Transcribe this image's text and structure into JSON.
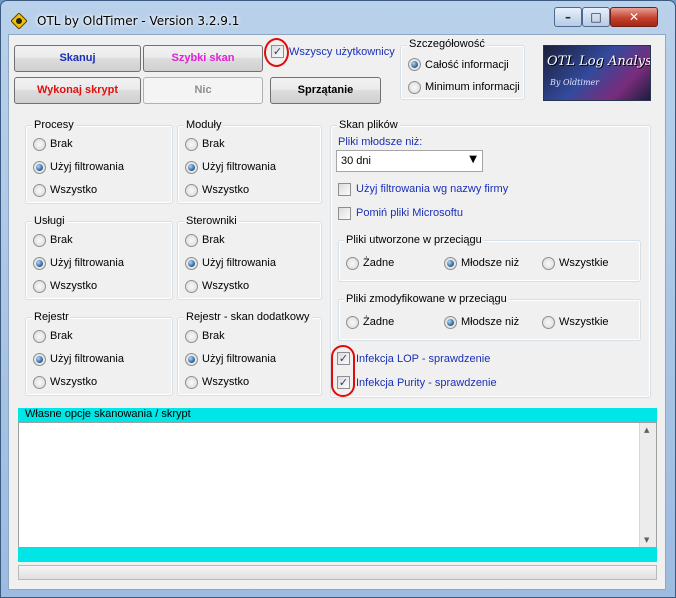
{
  "window": {
    "title": "OTL by OldTimer - Version 3.2.9.1",
    "minimize": "–",
    "maximize": "□",
    "close": "✕"
  },
  "toolbar": {
    "scan": "Skanuj",
    "quick_scan": "Szybki skan",
    "all_users": "Wszyscy użytkownicy",
    "all_users_checked": true,
    "run_script": "Wykonaj skrypt",
    "none": "Nic",
    "cleanup": "Sprzątanie"
  },
  "detail": {
    "title": "Szczegółowość",
    "full": "Całość informacji",
    "minimum": "Minimum informacji",
    "selected": "full"
  },
  "logo": {
    "line1": "OTL Log Analysis",
    "line2": "By Oldtimer"
  },
  "groups": {
    "procesy": {
      "title": "Procesy",
      "options": [
        "Brak",
        "Użyj filtrowania",
        "Wszystko"
      ],
      "selected": 1
    },
    "moduly": {
      "title": "Moduły",
      "options": [
        "Brak",
        "Użyj filtrowania",
        "Wszystko"
      ],
      "selected": 1
    },
    "uslugi": {
      "title": "Usługi",
      "options": [
        "Brak",
        "Użyj filtrowania",
        "Wszystko"
      ],
      "selected": 1
    },
    "sterowniki": {
      "title": "Sterowniki",
      "options": [
        "Brak",
        "Użyj filtrowania",
        "Wszystko"
      ],
      "selected": 1
    },
    "rejestr": {
      "title": "Rejestr",
      "options": [
        "Brak",
        "Użyj filtrowania",
        "Wszystko"
      ],
      "selected": 1
    },
    "rejestr_extra": {
      "title": "Rejestr - skan dodatkowy",
      "options": [
        "Brak",
        "Użyj filtrowania",
        "Wszystko"
      ],
      "selected": 1
    }
  },
  "file_scan": {
    "title": "Skan plików",
    "newer_label": "Pliki młodsze niż:",
    "newer_value": "30 dni",
    "company_filter": "Użyj filtrowania wg nazwy firmy",
    "company_filter_checked": false,
    "skip_ms": "Pomiń pliki Microsoftu",
    "skip_ms_checked": false,
    "created": {
      "title": "Pliki utworzone w przeciągu",
      "options": [
        "Żadne",
        "Młodsze niż",
        "Wszystkie"
      ],
      "selected": 1
    },
    "modified": {
      "title": "Pliki zmodyfikowane w przeciągu",
      "options": [
        "Żadne",
        "Młodsze niż",
        "Wszystkie"
      ],
      "selected": 1
    },
    "lop": "Infekcja LOP - sprawdzenie",
    "lop_checked": true,
    "purity": "Infekcja Purity - sprawdzenie",
    "purity_checked": true
  },
  "custom": {
    "title": "Własne opcje skanowania / skrypt",
    "value": ""
  },
  "colors": {
    "accent_bar": "#00e5e5",
    "highlight": "#e10b0b",
    "link_blue": "#1a2fb8"
  }
}
